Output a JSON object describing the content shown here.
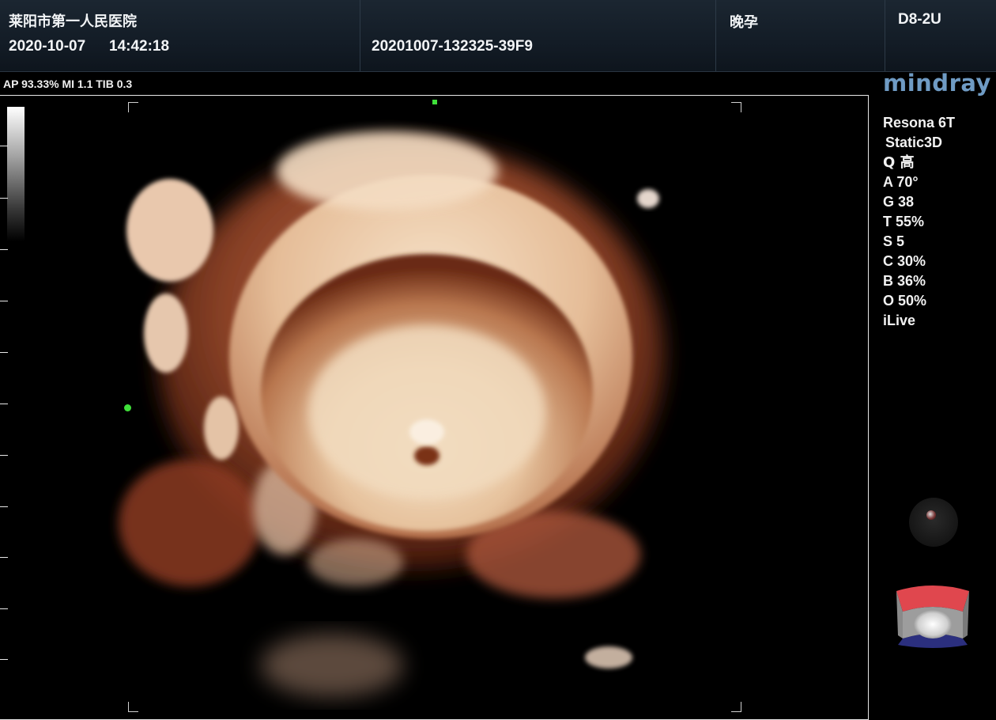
{
  "header": {
    "hospital_name": "莱阳市第一人民医院",
    "date": "2020-10-07",
    "time": "14:42:18",
    "patient_id": "20201007-132325-39F9",
    "exam_type": "晚孕",
    "probe": "D8-2U"
  },
  "acoustic_output": "AP 93.33%  MI 1.1 TIB 0.3",
  "logo": "mindray",
  "system": {
    "model": "Resona 6T",
    "mode": "Static3D"
  },
  "parameters": [
    "Q 高",
    "A 70°",
    "G 38",
    "T 55%",
    "S 5",
    "C 30%",
    "B 36%",
    "O 50%",
    "iLive"
  ],
  "colors": {
    "header_bg": "#131c26",
    "marker_green": "#3fe03a",
    "logo_blue": "#6f9bc4",
    "tissue_light": "#f3dcc0",
    "tissue_dark": "#8a3a24",
    "cube_red": "#e0474e",
    "cube_blue": "#2b2f7e"
  },
  "icons": {
    "trackball": "trackball-icon",
    "orientation": "orientation-cube-icon"
  }
}
